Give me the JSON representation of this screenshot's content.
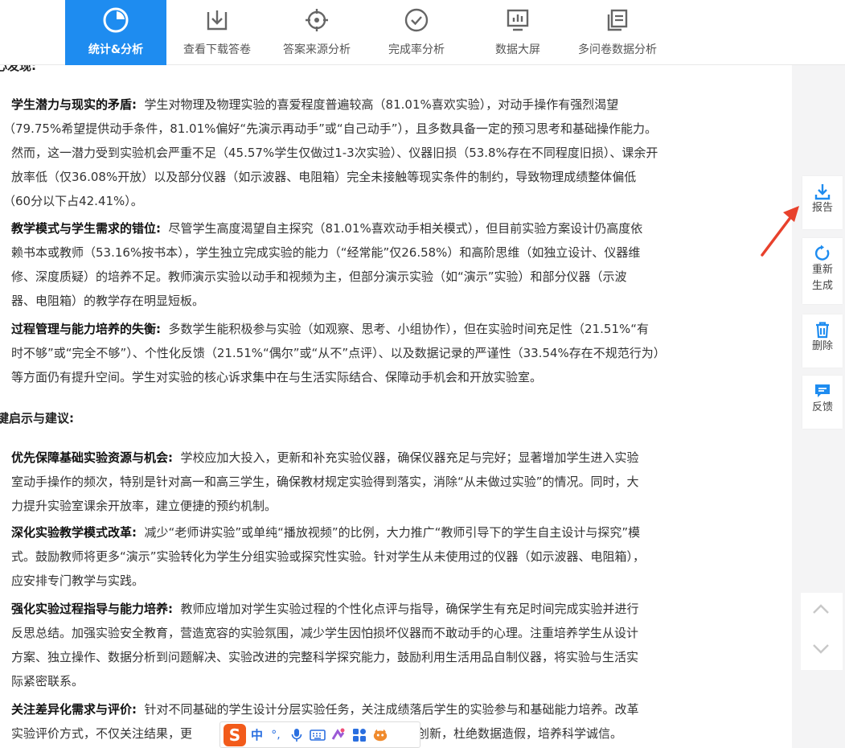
{
  "nav": {
    "items": [
      {
        "label": "统计&分析",
        "icon": "pie-chart-icon"
      },
      {
        "label": "查看下载答卷",
        "icon": "download-icon"
      },
      {
        "label": "答案来源分析",
        "icon": "crosshair-icon"
      },
      {
        "label": "完成率分析",
        "icon": "check-circle-icon"
      },
      {
        "label": "数据大屏",
        "icon": "monitor-chart-icon"
      },
      {
        "label": "多问卷数据分析",
        "icon": "copy-docs-icon"
      }
    ],
    "active_color": "#1e8cf0"
  },
  "content": {
    "partial_heading": "心发现:",
    "findings": [
      {
        "title": "学生潜力与现实的矛盾:",
        "lines": [
          "学生对物理及物理实验的喜爱程度普遍较高（81.01%喜欢实验），对动手操作有强烈渴望",
          "（79.75%希望提供动手条件，81.01%偏好“先演示再动手”或“自己动手”），且多数具备一定的预习思考和基础操作能力。",
          "然而，这一潜力受到实验机会严重不足（45.57%学生仅做过1-3次实验）、仪器旧损（53.8%存在不同程度旧损）、课余开",
          "放率低（仅36.08%开放）以及部分仪器（如示波器、电阻箱）完全未接触等现实条件的制约，导致物理成绩整体偏低",
          "（60分以下占42.41%）。"
        ]
      },
      {
        "title": "教学模式与学生需求的错位:",
        "lines": [
          "尽管学生高度渴望自主探究（81.01%喜欢动手相关模式），但目前实验方案设计仍高度依",
          "赖书本或教师（53.16%按书本），学生独立完成实验的能力（“经常能”仅26.58%）和高阶思维（如独立设计、仪器维",
          "修、深度质疑）的培养不足。教师演示实验以动手和视频为主，但部分演示实验（如“演示”实验）和部分仪器（示波",
          "器、电阻箱）的教学存在明显短板。"
        ]
      },
      {
        "title": "过程管理与能力培养的失衡:",
        "lines": [
          "多数学生能积极参与实验（如观察、思考、小组协作），但在实验时间充足性（21.51%“有",
          "时不够”或“完全不够”）、个性化反馈（21.51%“偶尔”或“从不”点评）、以及数据记录的严谨性（33.54%存在不规范行为）",
          "等方面仍有提升空间。学生对实验的核心诉求集中在与生活实际结合、保障动手机会和开放实验室。"
        ]
      }
    ],
    "section_heading": "键启示与建议:",
    "suggestions": [
      {
        "title": "优先保障基础实验资源与机会:",
        "lines": [
          "学校应加大投入，更新和补充实验仪器，确保仪器充足与完好；显著增加学生进入实验",
          "室动手操作的频次，特别是针对高一和高三学生，确保教材规定实验得到落实，消除“从未做过实验”的情况。同时，大",
          "力提升实验室课余开放率，建立便捷的预约机制。"
        ]
      },
      {
        "title": "深化实验教学模式改革:",
        "lines": [
          "减少“老师讲实验”或单纯“播放视频”的比例，大力推广“教师引导下的学生自主设计与探究”模",
          "式。鼓励教师将更多“演示”实验转化为学生分组实验或探究性实验。针对学生从未使用过的仪器（如示波器、电阻箱），",
          "应安排专门教学与实践。"
        ]
      },
      {
        "title": "强化实验过程指导与能力培养:",
        "lines": [
          "教师应增加对学生实验过程的个性化点评与指导，确保学生有充足时间完成实验并进行",
          "反思总结。加强实验安全教育，营造宽容的实验氛围，减少学生因怕损坏仪器而不敢动手的心理。注重培养学生从设计",
          "方案、独立操作、数据分析到问题解决、实验改进的完整科学探究能力，鼓励利用生活用品自制仪器，将实验与生活实",
          "际紧密联系。"
        ]
      },
      {
        "title": "关注差异化需求与评价:",
        "lines": [
          "针对不同基础的学生设计分层实验任务，关注成绩落后学生的实验参与和基础能力培养。改革",
          "实验评价方式，不仅关注结果，更",
          "作与创新，杜绝数据造假，培养科学诚信。"
        ]
      }
    ]
  },
  "sidebar": {
    "buttons": [
      {
        "label": "报告",
        "icon": "download-report-icon"
      },
      {
        "label": "重新生成",
        "icon": "refresh-icon"
      },
      {
        "label": "删除",
        "icon": "trash-icon"
      },
      {
        "label": "反馈",
        "icon": "feedback-icon"
      }
    ],
    "icon_color": "#1e8cf0"
  },
  "ime": {
    "logo": "S",
    "mode": "中",
    "punct": "°,"
  }
}
